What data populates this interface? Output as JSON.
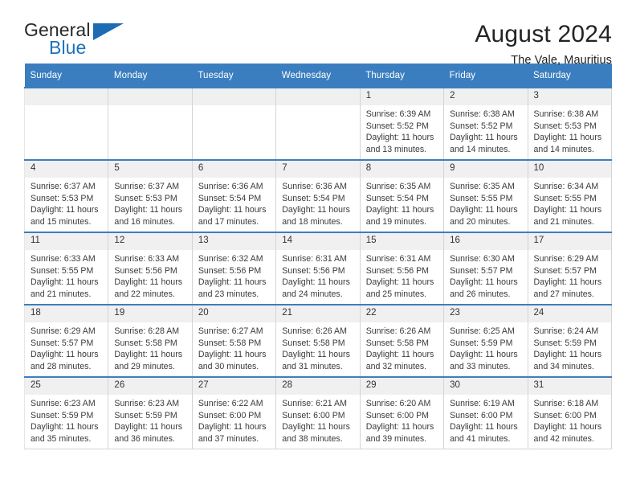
{
  "brand": {
    "name_part1": "General",
    "name_part2": "Blue",
    "triangle_icon": "triangle-logo-icon",
    "accent_color": "#1b6cb3"
  },
  "header": {
    "title": "August 2024",
    "location": "The Vale, Mauritius"
  },
  "calendar": {
    "header_background": "#3a7ebf",
    "daynum_background": "#f0f0f0",
    "weekdays": [
      "Sunday",
      "Monday",
      "Tuesday",
      "Wednesday",
      "Thursday",
      "Friday",
      "Saturday"
    ],
    "labels": {
      "sunrise_prefix": "Sunrise:",
      "sunset_prefix": "Sunset:",
      "daylight_prefix": "Daylight:"
    },
    "weeks": [
      [
        {
          "day": "",
          "empty": true
        },
        {
          "day": "",
          "empty": true
        },
        {
          "day": "",
          "empty": true
        },
        {
          "day": "",
          "empty": true
        },
        {
          "day": "1",
          "sunrise": "Sunrise: 6:39 AM",
          "sunset": "Sunset: 5:52 PM",
          "daylight_line1": "Daylight: 11 hours",
          "daylight_line2": "and 13 minutes."
        },
        {
          "day": "2",
          "sunrise": "Sunrise: 6:38 AM",
          "sunset": "Sunset: 5:52 PM",
          "daylight_line1": "Daylight: 11 hours",
          "daylight_line2": "and 14 minutes."
        },
        {
          "day": "3",
          "sunrise": "Sunrise: 6:38 AM",
          "sunset": "Sunset: 5:53 PM",
          "daylight_line1": "Daylight: 11 hours",
          "daylight_line2": "and 14 minutes."
        }
      ],
      [
        {
          "day": "4",
          "sunrise": "Sunrise: 6:37 AM",
          "sunset": "Sunset: 5:53 PM",
          "daylight_line1": "Daylight: 11 hours",
          "daylight_line2": "and 15 minutes."
        },
        {
          "day": "5",
          "sunrise": "Sunrise: 6:37 AM",
          "sunset": "Sunset: 5:53 PM",
          "daylight_line1": "Daylight: 11 hours",
          "daylight_line2": "and 16 minutes."
        },
        {
          "day": "6",
          "sunrise": "Sunrise: 6:36 AM",
          "sunset": "Sunset: 5:54 PM",
          "daylight_line1": "Daylight: 11 hours",
          "daylight_line2": "and 17 minutes."
        },
        {
          "day": "7",
          "sunrise": "Sunrise: 6:36 AM",
          "sunset": "Sunset: 5:54 PM",
          "daylight_line1": "Daylight: 11 hours",
          "daylight_line2": "and 18 minutes."
        },
        {
          "day": "8",
          "sunrise": "Sunrise: 6:35 AM",
          "sunset": "Sunset: 5:54 PM",
          "daylight_line1": "Daylight: 11 hours",
          "daylight_line2": "and 19 minutes."
        },
        {
          "day": "9",
          "sunrise": "Sunrise: 6:35 AM",
          "sunset": "Sunset: 5:55 PM",
          "daylight_line1": "Daylight: 11 hours",
          "daylight_line2": "and 20 minutes."
        },
        {
          "day": "10",
          "sunrise": "Sunrise: 6:34 AM",
          "sunset": "Sunset: 5:55 PM",
          "daylight_line1": "Daylight: 11 hours",
          "daylight_line2": "and 21 minutes."
        }
      ],
      [
        {
          "day": "11",
          "sunrise": "Sunrise: 6:33 AM",
          "sunset": "Sunset: 5:55 PM",
          "daylight_line1": "Daylight: 11 hours",
          "daylight_line2": "and 21 minutes."
        },
        {
          "day": "12",
          "sunrise": "Sunrise: 6:33 AM",
          "sunset": "Sunset: 5:56 PM",
          "daylight_line1": "Daylight: 11 hours",
          "daylight_line2": "and 22 minutes."
        },
        {
          "day": "13",
          "sunrise": "Sunrise: 6:32 AM",
          "sunset": "Sunset: 5:56 PM",
          "daylight_line1": "Daylight: 11 hours",
          "daylight_line2": "and 23 minutes."
        },
        {
          "day": "14",
          "sunrise": "Sunrise: 6:31 AM",
          "sunset": "Sunset: 5:56 PM",
          "daylight_line1": "Daylight: 11 hours",
          "daylight_line2": "and 24 minutes."
        },
        {
          "day": "15",
          "sunrise": "Sunrise: 6:31 AM",
          "sunset": "Sunset: 5:56 PM",
          "daylight_line1": "Daylight: 11 hours",
          "daylight_line2": "and 25 minutes."
        },
        {
          "day": "16",
          "sunrise": "Sunrise: 6:30 AM",
          "sunset": "Sunset: 5:57 PM",
          "daylight_line1": "Daylight: 11 hours",
          "daylight_line2": "and 26 minutes."
        },
        {
          "day": "17",
          "sunrise": "Sunrise: 6:29 AM",
          "sunset": "Sunset: 5:57 PM",
          "daylight_line1": "Daylight: 11 hours",
          "daylight_line2": "and 27 minutes."
        }
      ],
      [
        {
          "day": "18",
          "sunrise": "Sunrise: 6:29 AM",
          "sunset": "Sunset: 5:57 PM",
          "daylight_line1": "Daylight: 11 hours",
          "daylight_line2": "and 28 minutes."
        },
        {
          "day": "19",
          "sunrise": "Sunrise: 6:28 AM",
          "sunset": "Sunset: 5:58 PM",
          "daylight_line1": "Daylight: 11 hours",
          "daylight_line2": "and 29 minutes."
        },
        {
          "day": "20",
          "sunrise": "Sunrise: 6:27 AM",
          "sunset": "Sunset: 5:58 PM",
          "daylight_line1": "Daylight: 11 hours",
          "daylight_line2": "and 30 minutes."
        },
        {
          "day": "21",
          "sunrise": "Sunrise: 6:26 AM",
          "sunset": "Sunset: 5:58 PM",
          "daylight_line1": "Daylight: 11 hours",
          "daylight_line2": "and 31 minutes."
        },
        {
          "day": "22",
          "sunrise": "Sunrise: 6:26 AM",
          "sunset": "Sunset: 5:58 PM",
          "daylight_line1": "Daylight: 11 hours",
          "daylight_line2": "and 32 minutes."
        },
        {
          "day": "23",
          "sunrise": "Sunrise: 6:25 AM",
          "sunset": "Sunset: 5:59 PM",
          "daylight_line1": "Daylight: 11 hours",
          "daylight_line2": "and 33 minutes."
        },
        {
          "day": "24",
          "sunrise": "Sunrise: 6:24 AM",
          "sunset": "Sunset: 5:59 PM",
          "daylight_line1": "Daylight: 11 hours",
          "daylight_line2": "and 34 minutes."
        }
      ],
      [
        {
          "day": "25",
          "sunrise": "Sunrise: 6:23 AM",
          "sunset": "Sunset: 5:59 PM",
          "daylight_line1": "Daylight: 11 hours",
          "daylight_line2": "and 35 minutes."
        },
        {
          "day": "26",
          "sunrise": "Sunrise: 6:23 AM",
          "sunset": "Sunset: 5:59 PM",
          "daylight_line1": "Daylight: 11 hours",
          "daylight_line2": "and 36 minutes."
        },
        {
          "day": "27",
          "sunrise": "Sunrise: 6:22 AM",
          "sunset": "Sunset: 6:00 PM",
          "daylight_line1": "Daylight: 11 hours",
          "daylight_line2": "and 37 minutes."
        },
        {
          "day": "28",
          "sunrise": "Sunrise: 6:21 AM",
          "sunset": "Sunset: 6:00 PM",
          "daylight_line1": "Daylight: 11 hours",
          "daylight_line2": "and 38 minutes."
        },
        {
          "day": "29",
          "sunrise": "Sunrise: 6:20 AM",
          "sunset": "Sunset: 6:00 PM",
          "daylight_line1": "Daylight: 11 hours",
          "daylight_line2": "and 39 minutes."
        },
        {
          "day": "30",
          "sunrise": "Sunrise: 6:19 AM",
          "sunset": "Sunset: 6:00 PM",
          "daylight_line1": "Daylight: 11 hours",
          "daylight_line2": "and 41 minutes."
        },
        {
          "day": "31",
          "sunrise": "Sunrise: 6:18 AM",
          "sunset": "Sunset: 6:00 PM",
          "daylight_line1": "Daylight: 11 hours",
          "daylight_line2": "and 42 minutes."
        }
      ]
    ]
  }
}
